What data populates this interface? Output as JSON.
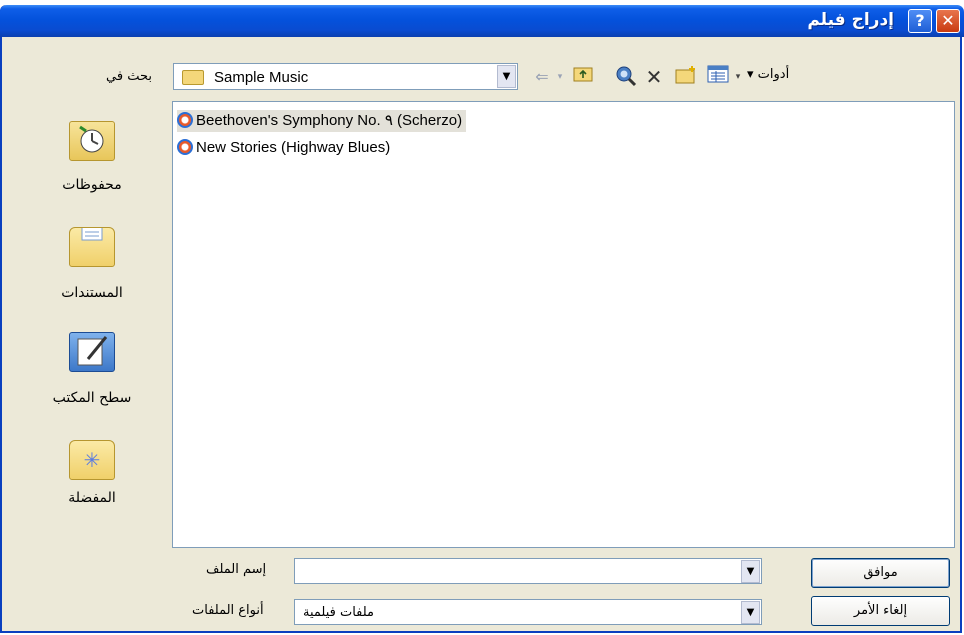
{
  "window": {
    "title": "إدراج فيلم",
    "help_button": "?",
    "close_button": "✕"
  },
  "lookin": {
    "label": "بحث في",
    "current_folder": "Sample Music"
  },
  "toolbar": {
    "back_icon": "back-arrow-icon",
    "tools_label": "أدوات ▾"
  },
  "places": [
    {
      "label": "محفوظات",
      "icon": "history-icon"
    },
    {
      "label": "المستندات",
      "icon": "documents-folder-icon"
    },
    {
      "label": "سطح المكتب",
      "icon": "desktop-icon"
    },
    {
      "label": "المفضلة",
      "icon": "favorites-icon"
    }
  ],
  "files": [
    {
      "name": "Beethoven's Symphony No. ٩ (Scherzo)"
    },
    {
      "name": "New Stories (Highway Blues)"
    }
  ],
  "filename": {
    "label": "إسم الملف",
    "value": ""
  },
  "filetype": {
    "label": "أنواع الملفات",
    "value": "ملفات فيلمية"
  },
  "buttons": {
    "ok": "موافق",
    "cancel": "إلغاء الأمر"
  }
}
